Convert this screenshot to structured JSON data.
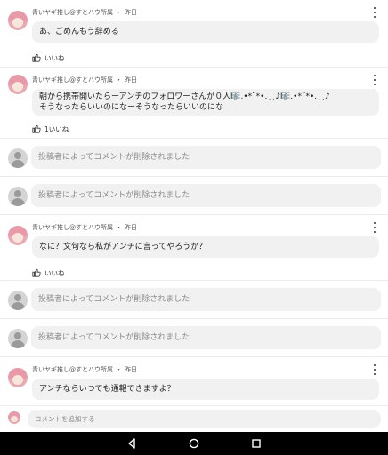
{
  "comments": [
    {
      "type": "full",
      "author": "青いヤギ推し@すとハウ所属",
      "time": "昨日",
      "text": "あ、ごめんもう辞める",
      "like_label": "いいね"
    },
    {
      "type": "full",
      "author": "青いヤギ推し@すとハウ所属",
      "time": "昨日",
      "text_line1": "朝から携帯開いたらーアンチのフォロワーさんが０人🎼.•*¨*•.¸¸♪🎼.•*¨*•.¸¸♪",
      "text_line2": "そうなったらいいのになーそうなったらいいのにな",
      "like_label": "1いいね"
    },
    {
      "type": "deleted",
      "text": "投稿者によってコメントが削除されました"
    },
    {
      "type": "deleted",
      "text": "投稿者によってコメントが削除されました"
    },
    {
      "type": "full",
      "author": "青いヤギ推し@すとハウ所属",
      "time": "昨日",
      "text": "なに？文句なら私がアンチに言ってやろうか？",
      "like_label": "いいね"
    },
    {
      "type": "deleted",
      "text": "投稿者によってコメントが削除されました"
    },
    {
      "type": "deleted",
      "text": "投稿者によってコメントが削除されました"
    },
    {
      "type": "full",
      "author": "青いヤギ推し@すとハウ所属",
      "time": "昨日",
      "text": "アンチならいつでも通報できますよ？"
    }
  ],
  "composer": {
    "placeholder": "コメントを追加する"
  },
  "navbar": {
    "icons": [
      "back-icon",
      "home-icon",
      "recents-icon"
    ]
  }
}
